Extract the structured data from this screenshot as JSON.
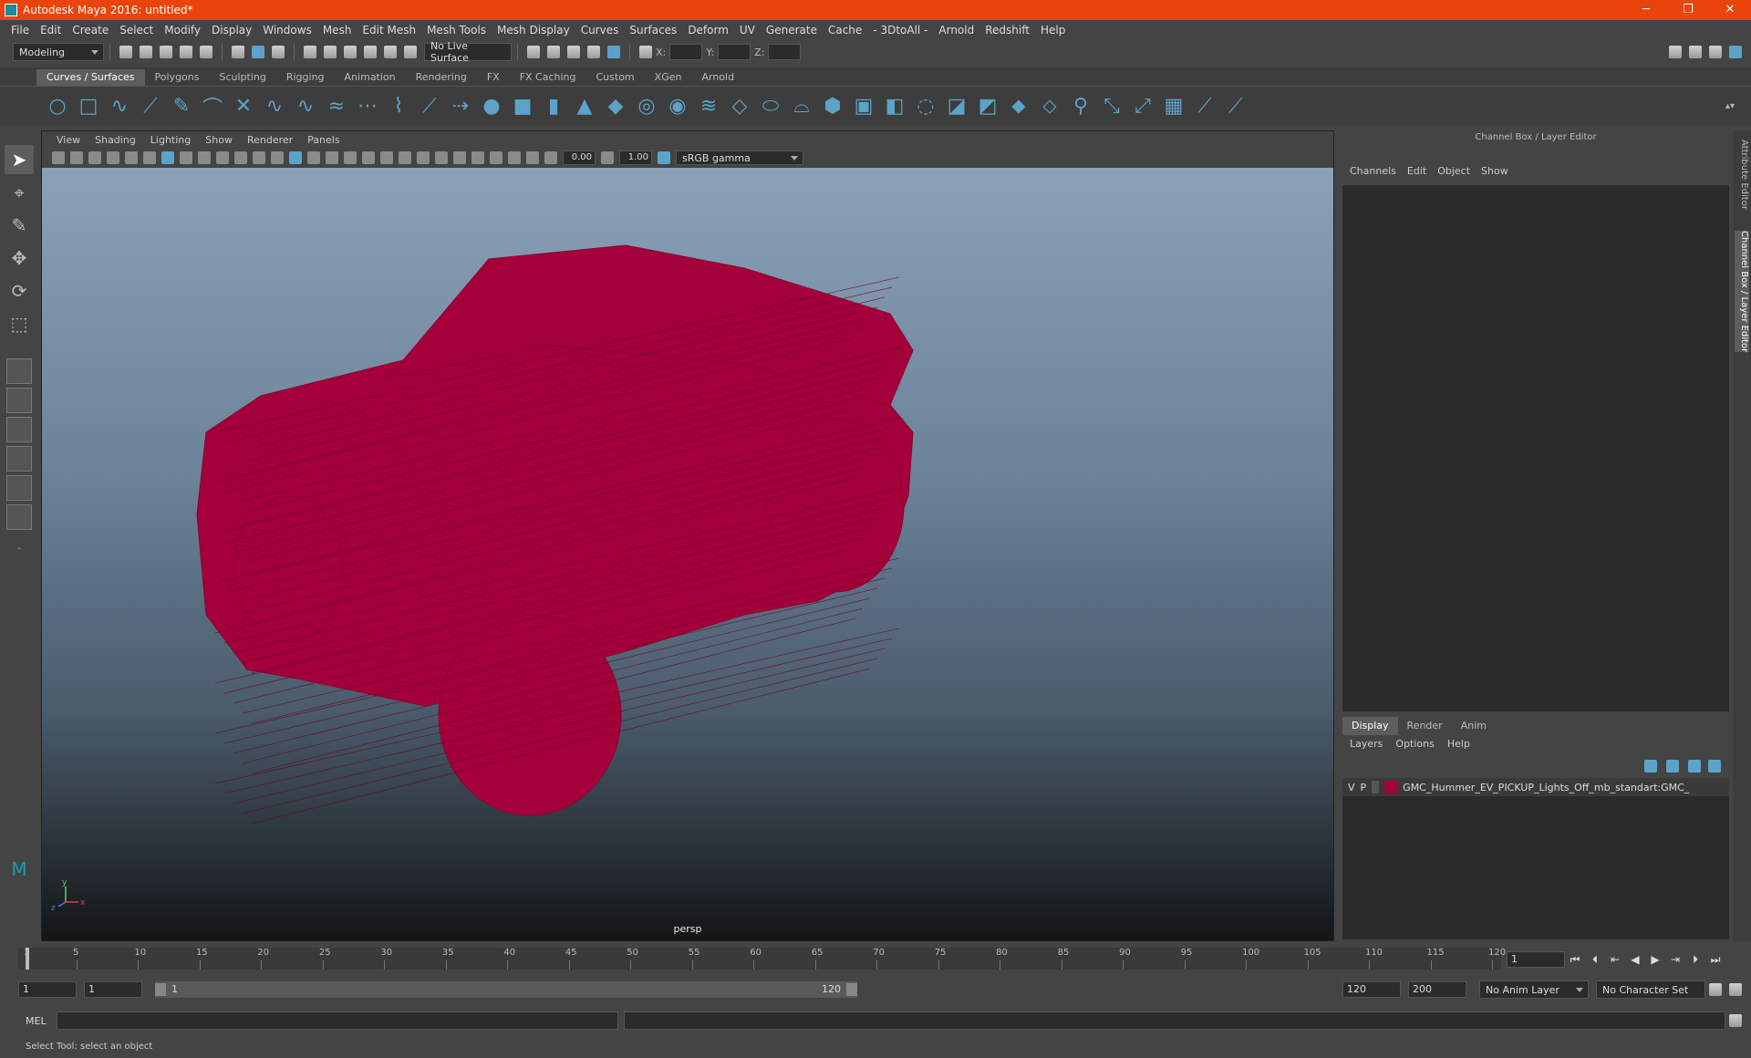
{
  "window": {
    "title": "Autodesk Maya 2016: untitled*",
    "minimize": "─",
    "restore": "❐",
    "close": "✕"
  },
  "menubar": [
    "File",
    "Edit",
    "Create",
    "Select",
    "Modify",
    "Display",
    "Windows",
    "Mesh",
    "Edit Mesh",
    "Mesh Tools",
    "Mesh Display",
    "Curves",
    "Surfaces",
    "Deform",
    "UV",
    "Generate",
    "Cache",
    "- 3DtoAll -",
    "Arnold",
    "Redshift",
    "Help"
  ],
  "statusline": {
    "menuset": "Modeling",
    "live_surface": "No Live Surface",
    "x_label": "X:",
    "y_label": "Y:",
    "z_label": "Z:"
  },
  "shelf": {
    "tabs": [
      "Curves / Surfaces",
      "Polygons",
      "Sculpting",
      "Rigging",
      "Animation",
      "Rendering",
      "FX",
      "FX Caching",
      "Custom",
      "XGen",
      "Arnold"
    ],
    "active_tab": "Curves / Surfaces"
  },
  "viewport": {
    "menus": [
      "View",
      "Shading",
      "Lighting",
      "Show",
      "Renderer",
      "Panels"
    ],
    "exposure": "0.00",
    "gamma": "1.00",
    "color_space": "sRGB gamma",
    "camera_label": "persp",
    "axis_y": "y",
    "axis_x": "x",
    "axis_z": "z",
    "wire_color": "#a4003a"
  },
  "channel_box": {
    "title": "Channel Box / Layer Editor",
    "menus": [
      "Channels",
      "Edit",
      "Object",
      "Show"
    ],
    "tabs": [
      "Display",
      "Render",
      "Anim"
    ],
    "active_tab": "Display",
    "layer_menus": [
      "Layers",
      "Options",
      "Help"
    ],
    "layers": [
      {
        "v": "V",
        "p": "P",
        "name": "GMC_Hummer_EV_PICKUP_Lights_Off_mb_standart:GMC_",
        "color": "#a4003a"
      }
    ]
  },
  "side_tabs": [
    "Attribute Editor",
    "Channel Box / Layer Editor"
  ],
  "timeslider": {
    "ticks": [
      "1",
      "5",
      "10",
      "15",
      "20",
      "25",
      "30",
      "35",
      "40",
      "45",
      "50",
      "55",
      "60",
      "65",
      "70",
      "75",
      "80",
      "85",
      "90",
      "95",
      "100",
      "105",
      "110",
      "115",
      "120"
    ],
    "current_frame": "1"
  },
  "rangeslider": {
    "start": "1",
    "playback_start": "1",
    "range_start_label": "1",
    "range_end_label": "120",
    "playback_end": "120",
    "end": "200",
    "anim_layer": "No Anim Layer",
    "character_set": "No Character Set"
  },
  "cmdline": {
    "label": "MEL"
  },
  "helpline": "Select Tool: select an object"
}
